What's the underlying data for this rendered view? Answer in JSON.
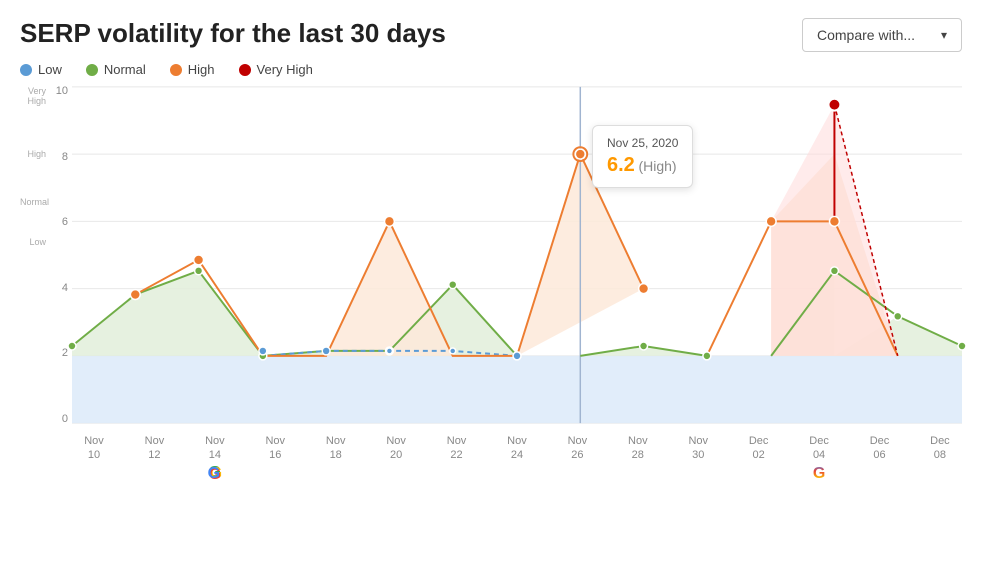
{
  "header": {
    "title": "SERP volatility for the last 30 days",
    "compare_btn": "Compare with...",
    "chevron": "▾"
  },
  "legend": [
    {
      "id": "low",
      "label": "Low",
      "color": "#5b9bd5",
      "border": "#5b9bd5"
    },
    {
      "id": "normal",
      "label": "Normal",
      "color": "#70ad47",
      "border": "#70ad47"
    },
    {
      "id": "high",
      "label": "High",
      "color": "#ed7d31",
      "border": "#ed7d31"
    },
    {
      "id": "very-high",
      "label": "Very High",
      "color": "#c00000",
      "border": "#c00000"
    }
  ],
  "y_axis": {
    "labels": [
      "10",
      "8",
      "6",
      "4",
      "2",
      "0"
    ],
    "sections": [
      "Very High",
      "High",
      "Normal",
      "Low"
    ]
  },
  "x_labels": [
    {
      "line1": "Nov",
      "line2": "10"
    },
    {
      "line1": "Nov",
      "line2": "12"
    },
    {
      "line1": "Nov",
      "line2": "14"
    },
    {
      "line1": "Nov",
      "line2": "16"
    },
    {
      "line1": "Nov",
      "line2": "18"
    },
    {
      "line1": "Nov",
      "line2": "20"
    },
    {
      "line1": "Nov",
      "line2": "22"
    },
    {
      "line1": "Nov",
      "line2": "24"
    },
    {
      "line1": "Nov",
      "line2": "26"
    },
    {
      "line1": "Nov",
      "line2": "28"
    },
    {
      "line1": "Nov",
      "line2": "30"
    },
    {
      "line1": "Dec",
      "line2": "02"
    },
    {
      "line1": "Dec",
      "line2": "04"
    },
    {
      "line1": "Dec",
      "line2": "06"
    },
    {
      "line1": "Dec",
      "line2": "08"
    }
  ],
  "tooltip": {
    "date": "Nov 25, 2020",
    "value": "6.2",
    "label": "(High)"
  },
  "google_icons": [
    {
      "x_index": 7,
      "label": "G"
    },
    {
      "x_index": 12,
      "label": "G"
    }
  ],
  "chart_colors": {
    "low_fill": "#dbeaf9",
    "normal_fill": "#e2efda",
    "high_fill": "#fde9d9",
    "very_high_fill": "#ffd7d7",
    "grid_line": "#e8e8e8",
    "tooltip_line": "#a0b4d0"
  }
}
